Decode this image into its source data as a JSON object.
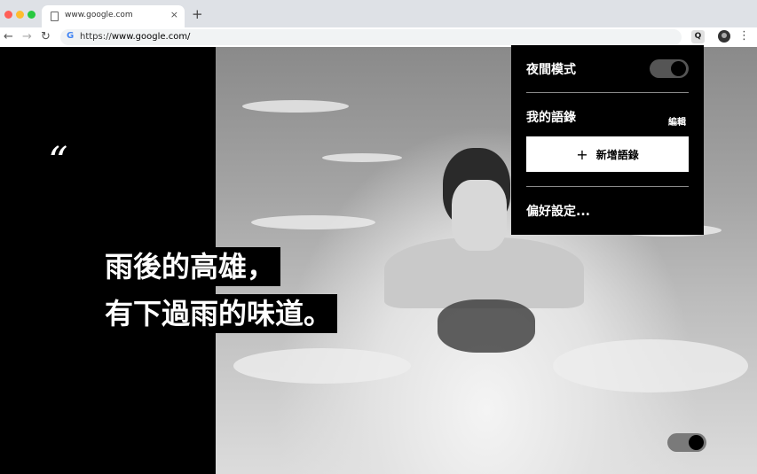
{
  "browser": {
    "tab_title": "www.google.com",
    "tab_close": "×",
    "new_tab": "+",
    "url_prefix": "https://",
    "url_host": "www.google.com/",
    "favicon": "G",
    "extension_icon_label": "Q",
    "icons": [
      "back-arrow-icon",
      "forward-arrow-icon",
      "reload-icon",
      "page-icon",
      "google-icon",
      "extension-icon",
      "avatar",
      "more-menu-icon"
    ]
  },
  "quote": {
    "mark": "“",
    "line1": "雨後的高雄，",
    "line2": "有下過雨的味道。"
  },
  "menu": {
    "night_mode_label": "夜間模式",
    "night_mode_on": true,
    "my_quotes_label": "我的語錄",
    "edit_label": "編輯",
    "add_quote_plus": "+",
    "add_quote_label": "新增語錄",
    "preferences_label": "偏好設定..."
  },
  "page": {
    "bottom_toggle_on": true
  },
  "colors": {
    "background": "#000000",
    "menu_bg": "#000000",
    "add_button_bg": "#ffffff",
    "toggle_track": "#555555"
  }
}
